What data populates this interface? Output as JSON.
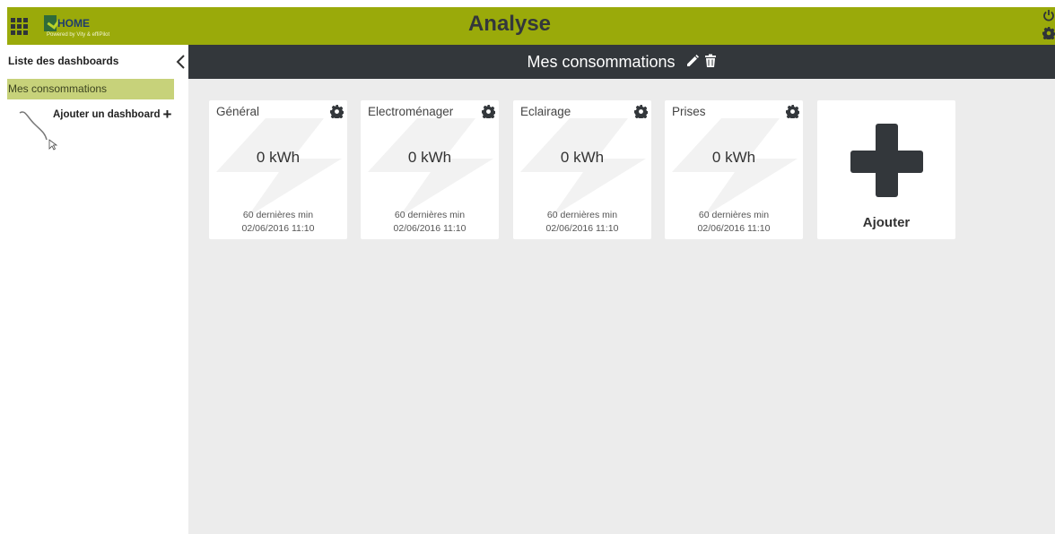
{
  "app": {
    "title": "Analyse",
    "logo_text": "HOME",
    "logo_subtitle": "Powered by Vity & effiPilot",
    "icons": {
      "menu": "grid-icon",
      "power": "power-icon",
      "settings": "gear-icon"
    }
  },
  "sidebar": {
    "title": "Liste des dashboards",
    "items": [
      {
        "label": "Mes consommations",
        "selected": true
      }
    ],
    "add_label": "Ajouter un dashboard",
    "add_icon": "+"
  },
  "dashboard": {
    "title": "Mes consommations",
    "icons": [
      "pencil-icon",
      "trash-icon"
    ]
  },
  "cards": [
    {
      "title": "Général",
      "value": "0 kWh",
      "period": "60 dernières min",
      "date": "02/06/2016 11:10"
    },
    {
      "title": "Electroménager",
      "value": "0 kWh",
      "period": "60 dernières min",
      "date": "02/06/2016 11:10"
    },
    {
      "title": "Eclairage",
      "value": "0 kWh",
      "period": "60 dernières min",
      "date": "02/06/2016 11:10"
    },
    {
      "title": "Prises",
      "value": "0 kWh",
      "period": "60 dernières min",
      "date": "02/06/2016 11:10"
    }
  ],
  "add_card": {
    "label": "Ajouter"
  },
  "colors": {
    "accent": "#9aaa0a",
    "dark": "#33373b",
    "selected": "#c7d27a",
    "background": "#ececec"
  }
}
